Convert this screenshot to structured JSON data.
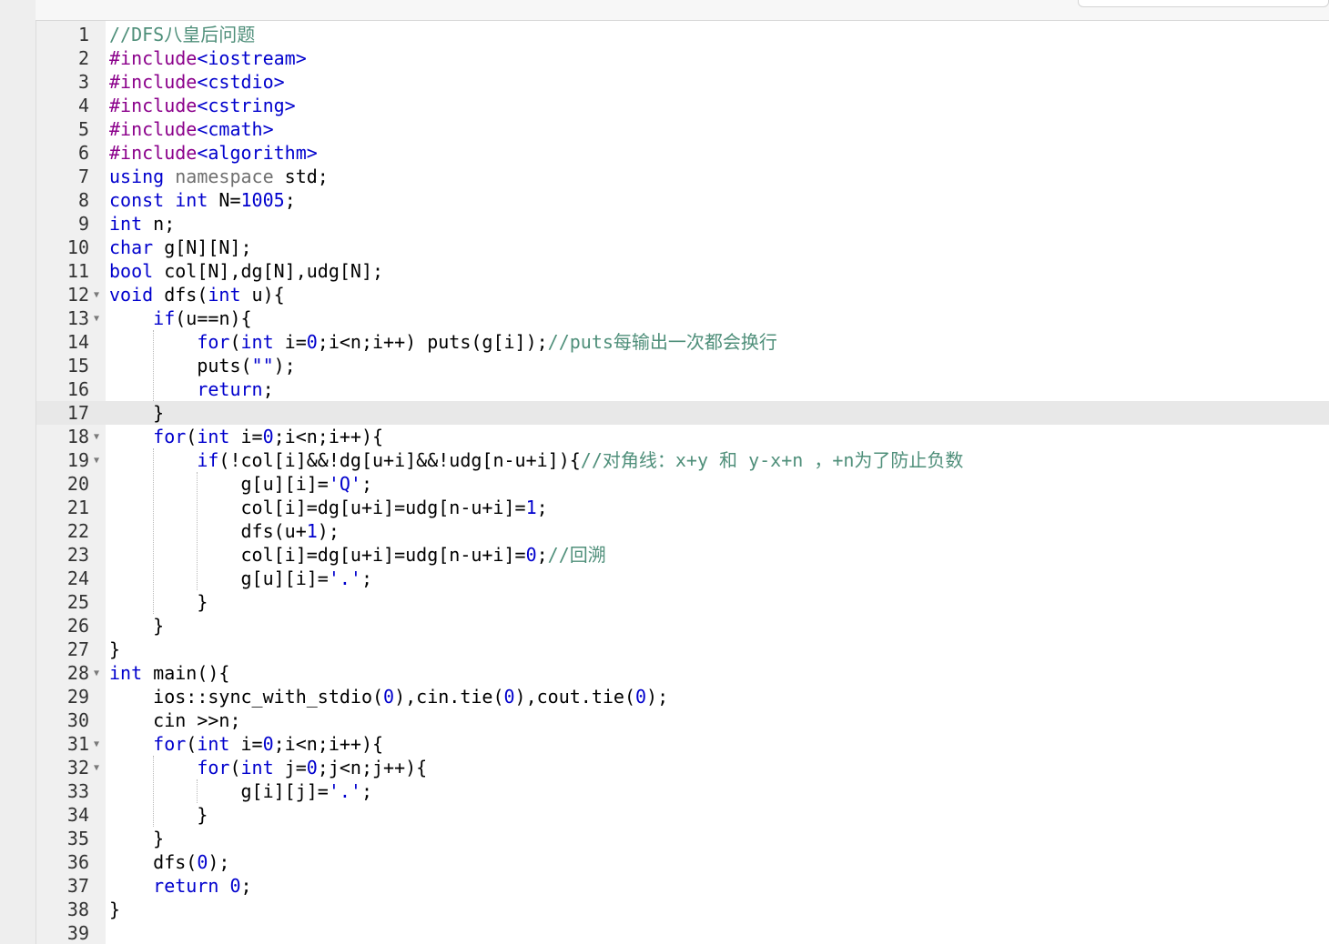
{
  "editor": {
    "active_line": 17,
    "lines": [
      [
        [
          "c",
          "//DFS八皇后问题"
        ]
      ],
      [
        [
          "p",
          "#include"
        ],
        [
          "s",
          "<iostream>"
        ]
      ],
      [
        [
          "p",
          "#include"
        ],
        [
          "s",
          "<cstdio>"
        ]
      ],
      [
        [
          "p",
          "#include"
        ],
        [
          "s",
          "<cstring>"
        ]
      ],
      [
        [
          "p",
          "#include"
        ],
        [
          "s",
          "<cmath>"
        ]
      ],
      [
        [
          "p",
          "#include"
        ],
        [
          "s",
          "<algorithm>"
        ]
      ],
      [
        [
          "k",
          "using"
        ],
        [
          "n",
          " "
        ],
        [
          "ns",
          "namespace"
        ],
        [
          "n",
          " std;"
        ]
      ],
      [
        [
          "k",
          "const"
        ],
        [
          "n",
          " "
        ],
        [
          "k",
          "int"
        ],
        [
          "n",
          " N="
        ],
        [
          "m",
          "1005"
        ],
        [
          "n",
          ";"
        ]
      ],
      [
        [
          "k",
          "int"
        ],
        [
          "n",
          " n;"
        ]
      ],
      [
        [
          "k",
          "char"
        ],
        [
          "n",
          " g[N][N];"
        ]
      ],
      [
        [
          "k",
          "bool"
        ],
        [
          "n",
          " col[N],dg[N],udg[N];"
        ]
      ],
      [
        [
          "k",
          "void"
        ],
        [
          "n",
          " dfs("
        ],
        [
          "k",
          "int"
        ],
        [
          "n",
          " u){"
        ]
      ],
      [
        [
          "n",
          "    "
        ],
        [
          "k",
          "if"
        ],
        [
          "n",
          "(u=="
        ],
        [
          "n",
          "n){"
        ]
      ],
      [
        [
          "n",
          "        "
        ],
        [
          "k",
          "for"
        ],
        [
          "n",
          "("
        ],
        [
          "k",
          "int"
        ],
        [
          "n",
          " i="
        ],
        [
          "m",
          "0"
        ],
        [
          "n",
          ";i<n;i++) puts(g[i]);"
        ],
        [
          "c",
          "//puts每输出一次都会换行"
        ]
      ],
      [
        [
          "n",
          "        puts("
        ],
        [
          "s",
          "\"\""
        ],
        [
          "n",
          ");"
        ]
      ],
      [
        [
          "n",
          "        "
        ],
        [
          "k",
          "return"
        ],
        [
          "n",
          ";"
        ]
      ],
      [
        [
          "n",
          "    }"
        ]
      ],
      [
        [
          "n",
          "    "
        ],
        [
          "k",
          "for"
        ],
        [
          "n",
          "("
        ],
        [
          "k",
          "int"
        ],
        [
          "n",
          " i="
        ],
        [
          "m",
          "0"
        ],
        [
          "n",
          ";i<n;i++){"
        ]
      ],
      [
        [
          "n",
          "        "
        ],
        [
          "k",
          "if"
        ],
        [
          "n",
          "(!col[i]&&!dg[u+i]&&!udg[n-u+i]){"
        ],
        [
          "c",
          "//对角线：x+y 和 y-x+n ，+n为了防止负数"
        ]
      ],
      [
        [
          "n",
          "            g[u][i]="
        ],
        [
          "s",
          "'Q'"
        ],
        [
          "n",
          ";"
        ]
      ],
      [
        [
          "n",
          "            col[i]=dg[u+i]=udg[n-u+i]="
        ],
        [
          "m",
          "1"
        ],
        [
          "n",
          ";"
        ]
      ],
      [
        [
          "n",
          "            dfs(u+"
        ],
        [
          "m",
          "1"
        ],
        [
          "n",
          ");"
        ]
      ],
      [
        [
          "n",
          "            col[i]=dg[u+i]=udg[n-u+i]="
        ],
        [
          "m",
          "0"
        ],
        [
          "n",
          ";"
        ],
        [
          "c",
          "//回溯"
        ]
      ],
      [
        [
          "n",
          "            g[u][i]="
        ],
        [
          "s",
          "'.'"
        ],
        [
          "n",
          ";"
        ]
      ],
      [
        [
          "n",
          "        }"
        ]
      ],
      [
        [
          "n",
          "    }"
        ]
      ],
      [
        [
          "n",
          "}"
        ]
      ],
      [
        [
          "k",
          "int"
        ],
        [
          "n",
          " main(){"
        ]
      ],
      [
        [
          "n",
          "    ios::sync_with_stdio("
        ],
        [
          "m",
          "0"
        ],
        [
          "n",
          "),cin.tie("
        ],
        [
          "m",
          "0"
        ],
        [
          "n",
          "),cout.tie("
        ],
        [
          "m",
          "0"
        ],
        [
          "n",
          ");"
        ]
      ],
      [
        [
          "n",
          "    cin >>n;"
        ]
      ],
      [
        [
          "n",
          "    "
        ],
        [
          "k",
          "for"
        ],
        [
          "n",
          "("
        ],
        [
          "k",
          "int"
        ],
        [
          "n",
          " i="
        ],
        [
          "m",
          "0"
        ],
        [
          "n",
          ";i<n;i++){"
        ]
      ],
      [
        [
          "n",
          "        "
        ],
        [
          "k",
          "for"
        ],
        [
          "n",
          "("
        ],
        [
          "k",
          "int"
        ],
        [
          "n",
          " j="
        ],
        [
          "m",
          "0"
        ],
        [
          "n",
          ";j<n;j++){"
        ]
      ],
      [
        [
          "n",
          "            g[i][j]="
        ],
        [
          "s",
          "'.'"
        ],
        [
          "n",
          ";"
        ]
      ],
      [
        [
          "n",
          "        }"
        ]
      ],
      [
        [
          "n",
          "    }"
        ]
      ],
      [
        [
          "n",
          "    dfs("
        ],
        [
          "m",
          "0"
        ],
        [
          "n",
          ");"
        ]
      ],
      [
        [
          "n",
          "    "
        ],
        [
          "k",
          "return"
        ],
        [
          "n",
          " "
        ],
        [
          "m",
          "0"
        ],
        [
          "n",
          ";"
        ]
      ],
      [
        [
          "n",
          "}"
        ]
      ],
      [
        [
          "n",
          ""
        ]
      ]
    ],
    "foldable_lines": [
      12,
      13,
      18,
      19,
      28,
      31,
      32
    ],
    "fold_icon": "triangle-down-icon"
  },
  "colors": {
    "keyword": "#0000cd",
    "preprocessor": "#8b008b",
    "comment": "#4f8f7a",
    "gutter_bg": "#f0f0f0",
    "active_line_bg": "#e8e8e8"
  }
}
